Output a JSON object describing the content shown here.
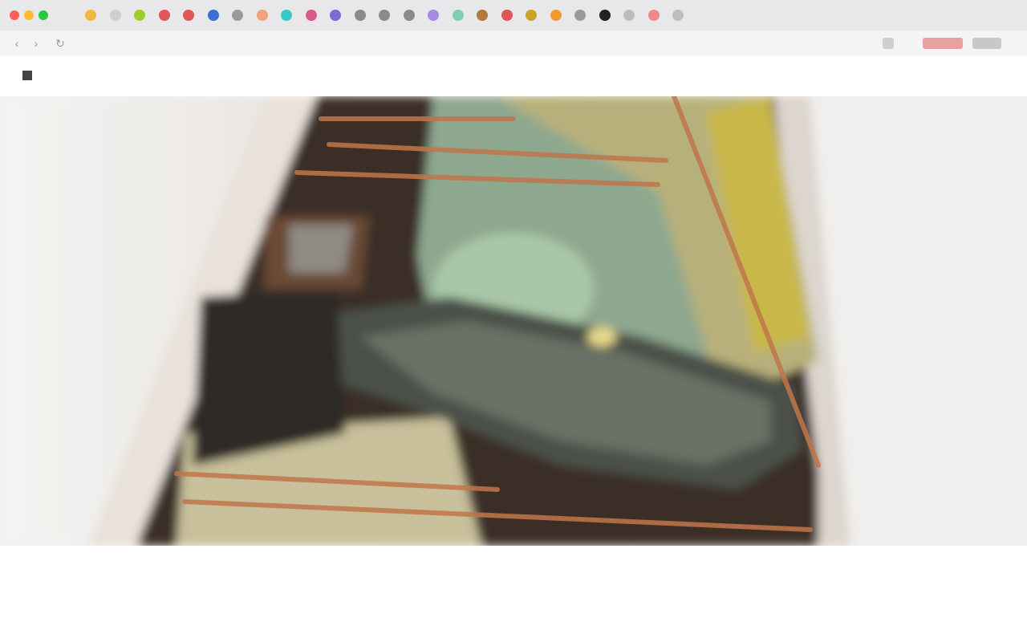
{
  "browser": {
    "tabs": [
      {
        "color": "#f4b740",
        "label": ""
      },
      {
        "color": "#cfcfcf",
        "label": ""
      },
      {
        "color": "#9ccf2a",
        "label": ""
      },
      {
        "color": "#e05656",
        "label": ""
      },
      {
        "color": "#e05656",
        "label": ""
      },
      {
        "color": "#3b6fd6",
        "label": ""
      },
      {
        "color": "#9a9a9a",
        "label": ""
      },
      {
        "color": "#f1a27b",
        "label": ""
      },
      {
        "color": "#36c9c6",
        "label": ""
      },
      {
        "color": "#d9578a",
        "label": ""
      },
      {
        "color": "#7a6cd6",
        "label": ""
      },
      {
        "color": "#8a8a8a",
        "label": ""
      },
      {
        "color": "#8a8a8a",
        "label": ""
      },
      {
        "color": "#8a8a8a",
        "label": ""
      },
      {
        "color": "#a78be0",
        "label": ""
      },
      {
        "color": "#7fd0b0",
        "label": ""
      },
      {
        "color": "#b07a3a",
        "label": ""
      },
      {
        "color": "#e05656",
        "label": ""
      },
      {
        "color": "#c9a227",
        "label": ""
      },
      {
        "color": "#f29a2e",
        "label": ""
      },
      {
        "color": "#9a9a9a",
        "label": ""
      },
      {
        "color": "#222222",
        "label": ""
      },
      {
        "color": "#bdbdbd",
        "label": ""
      },
      {
        "color": "#f08a8a",
        "label": ""
      },
      {
        "color": "#bdbdbd",
        "label": ""
      }
    ],
    "url": ""
  },
  "site": {
    "logo_text": "",
    "nav": [
      "",
      "",
      ""
    ]
  },
  "caption": {
    "title": "",
    "subtitle": ""
  }
}
